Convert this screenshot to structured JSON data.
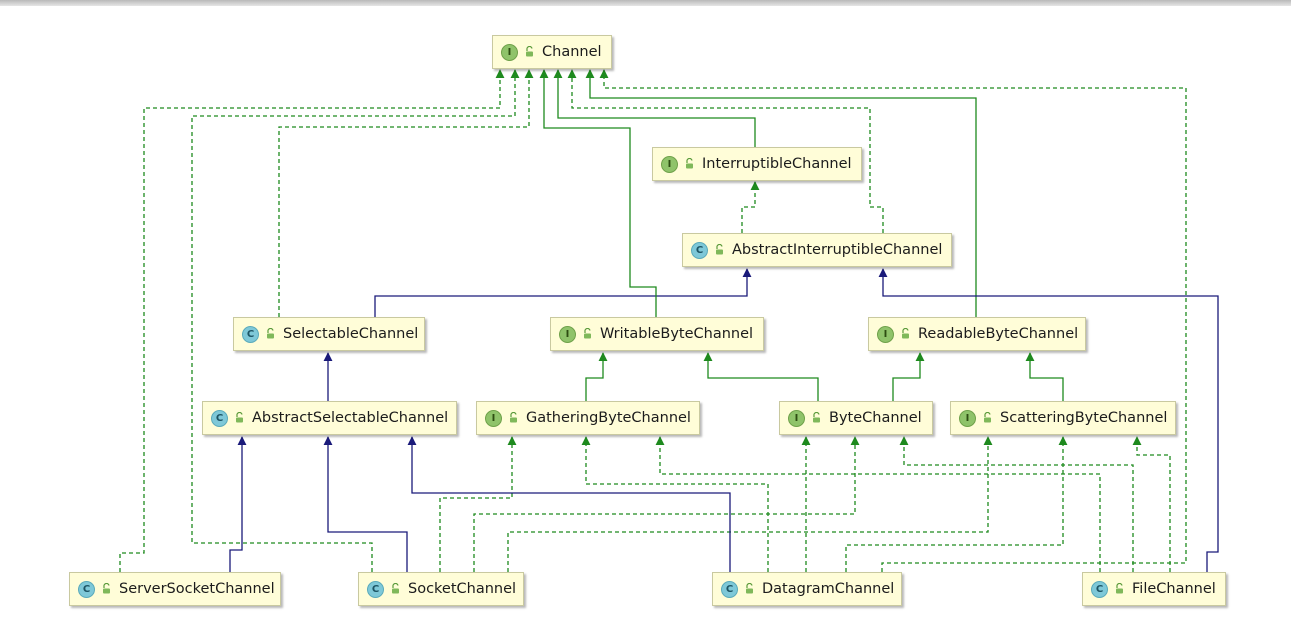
{
  "diagram": {
    "nodes": [
      {
        "id": "channel",
        "kind": "interface",
        "kind_letter": "I",
        "label": "Channel"
      },
      {
        "id": "interruptible",
        "kind": "interface",
        "kind_letter": "I",
        "label": "InterruptibleChannel"
      },
      {
        "id": "abstract-interruptible",
        "kind": "class",
        "kind_letter": "C",
        "label": "AbstractInterruptibleChannel"
      },
      {
        "id": "selectable",
        "kind": "class",
        "kind_letter": "C",
        "label": "SelectableChannel"
      },
      {
        "id": "writable",
        "kind": "interface",
        "kind_letter": "I",
        "label": "WritableByteChannel"
      },
      {
        "id": "readable",
        "kind": "interface",
        "kind_letter": "I",
        "label": "ReadableByteChannel"
      },
      {
        "id": "abstract-selectable",
        "kind": "class",
        "kind_letter": "C",
        "label": "AbstractSelectableChannel"
      },
      {
        "id": "gathering",
        "kind": "interface",
        "kind_letter": "I",
        "label": "GatheringByteChannel"
      },
      {
        "id": "bytechannel",
        "kind": "interface",
        "kind_letter": "I",
        "label": "ByteChannel"
      },
      {
        "id": "scattering",
        "kind": "interface",
        "kind_letter": "I",
        "label": "ScatteringByteChannel"
      },
      {
        "id": "server-socket",
        "kind": "class",
        "kind_letter": "C",
        "label": "ServerSocketChannel"
      },
      {
        "id": "socket",
        "kind": "class",
        "kind_letter": "C",
        "label": "SocketChannel"
      },
      {
        "id": "datagram",
        "kind": "class",
        "kind_letter": "C",
        "label": "DatagramChannel"
      },
      {
        "id": "filechannel",
        "kind": "class",
        "kind_letter": "C",
        "label": "FileChannel"
      }
    ],
    "edges": [
      {
        "from": "interruptible",
        "to": "channel",
        "type": "extends-interface"
      },
      {
        "from": "abstract-interruptible",
        "to": "interruptible",
        "type": "implements"
      },
      {
        "from": "abstract-interruptible",
        "to": "channel",
        "type": "implements"
      },
      {
        "from": "selectable",
        "to": "abstract-interruptible",
        "type": "extends-class"
      },
      {
        "from": "selectable",
        "to": "channel",
        "type": "implements"
      },
      {
        "from": "writable",
        "to": "channel",
        "type": "extends-interface"
      },
      {
        "from": "readable",
        "to": "channel",
        "type": "extends-interface"
      },
      {
        "from": "abstract-selectable",
        "to": "selectable",
        "type": "extends-class"
      },
      {
        "from": "gathering",
        "to": "writable",
        "type": "extends-interface"
      },
      {
        "from": "bytechannel",
        "to": "writable",
        "type": "extends-interface"
      },
      {
        "from": "bytechannel",
        "to": "readable",
        "type": "extends-interface"
      },
      {
        "from": "scattering",
        "to": "readable",
        "type": "extends-interface"
      },
      {
        "from": "server-socket",
        "to": "abstract-selectable",
        "type": "extends-class"
      },
      {
        "from": "server-socket",
        "to": "channel",
        "type": "implements"
      },
      {
        "from": "socket",
        "to": "abstract-selectable",
        "type": "extends-class"
      },
      {
        "from": "socket",
        "to": "channel",
        "type": "implements"
      },
      {
        "from": "socket",
        "to": "gathering",
        "type": "implements"
      },
      {
        "from": "socket",
        "to": "bytechannel",
        "type": "implements"
      },
      {
        "from": "socket",
        "to": "scattering",
        "type": "implements"
      },
      {
        "from": "datagram",
        "to": "abstract-selectable",
        "type": "extends-class"
      },
      {
        "from": "datagram",
        "to": "gathering",
        "type": "implements"
      },
      {
        "from": "datagram",
        "to": "bytechannel",
        "type": "implements"
      },
      {
        "from": "datagram",
        "to": "scattering",
        "type": "implements"
      },
      {
        "from": "filechannel",
        "to": "abstract-interruptible",
        "type": "extends-class"
      },
      {
        "from": "filechannel",
        "to": "gathering",
        "type": "implements"
      },
      {
        "from": "filechannel",
        "to": "bytechannel",
        "type": "implements"
      },
      {
        "from": "filechannel",
        "to": "scattering",
        "type": "implements"
      },
      {
        "from": "filechannel",
        "to": "channel",
        "type": "implements"
      }
    ],
    "colors": {
      "interface_edge": "#1e8a1e",
      "class_edge": "#1a1a7a",
      "node_fill": "#fffdd8",
      "interface_badge": "#8fc36a",
      "class_badge": "#7ec8d8"
    }
  }
}
